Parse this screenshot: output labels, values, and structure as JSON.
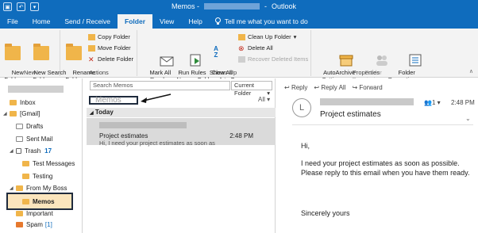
{
  "titlebar": {
    "title_prefix": "Memos -",
    "app": "Outlook"
  },
  "tabs": [
    {
      "label": "File"
    },
    {
      "label": "Home"
    },
    {
      "label": "Send / Receive"
    },
    {
      "label": "Folder"
    },
    {
      "label": "View"
    },
    {
      "label": "Help"
    }
  ],
  "tell_me": "Tell me what you want to do",
  "ribbon": {
    "new_folder": "New\nFolder",
    "new_search_folder": "New Search\nFolder",
    "group_new": "New",
    "rename_folder": "Rename\nFolder",
    "copy_folder": "Copy Folder",
    "move_folder": "Move Folder",
    "delete_folder": "Delete Folder",
    "group_actions": "Actions",
    "mark_all_read": "Mark All\nas Read",
    "run_rules": "Run Rules\nNow",
    "show_all_folders": "Show All\nFolders A to Z",
    "clean_up_folder": "Clean Up Folder",
    "delete_all": "Delete All",
    "recover_deleted": "Recover Deleted Items",
    "group_cleanup": "Clean Up",
    "autoarchive": "AutoArchive\nSettings",
    "folder_permissions": "Folder\nPermissions",
    "folder_properties": "Folder\nProperties",
    "group_properties": "Properties"
  },
  "folders": [
    {
      "label": "Inbox"
    },
    {
      "label": "[Gmail]"
    },
    {
      "label": "Drafts"
    },
    {
      "label": "Sent Mail"
    },
    {
      "label": "Trash",
      "count": "17"
    },
    {
      "label": "Test Messages"
    },
    {
      "label": "Testing"
    },
    {
      "label": "From My Boss"
    },
    {
      "label": "Memos"
    },
    {
      "label": "Important"
    },
    {
      "label": "Spam",
      "count": "[1]"
    }
  ],
  "search": {
    "placeholder": "Search Memos",
    "scope": "Current Folder"
  },
  "folder_name": "Memos",
  "filter": "All",
  "group_header": "Today",
  "message": {
    "subject": "Project estimates",
    "time": "2:48 PM",
    "preview": "Hi,  I need your project estimates as soon as"
  },
  "reading": {
    "reply": "Reply",
    "reply_all": "Reply All",
    "forward": "Forward",
    "avatar_letter": "L",
    "subject": "Project estimates",
    "people": "1",
    "time": "2:48 PM",
    "greeting": "Hi,",
    "body": "I need your project estimates as soon as possible. Please reply to this email when you have them ready.",
    "closing": "Sincerely yours"
  }
}
